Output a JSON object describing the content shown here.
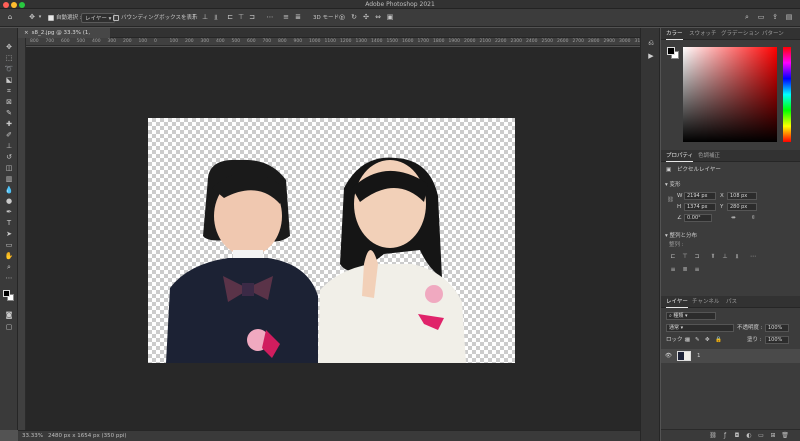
{
  "app": {
    "title": "Adobe Photoshop 2021"
  },
  "window_controls": {
    "close_color": "#ff5f57",
    "minimize_color": "#febc2e",
    "zoom_color": "#28c840"
  },
  "options_bar": {
    "auto_select_label": "自動選択 :",
    "auto_select_checked": true,
    "target_value": "レイヤー",
    "bounding_box_label": "バウンディングボックスを表示",
    "bounding_box_checked": false,
    "three_d_mode_label": "3D モード :"
  },
  "document": {
    "tab_label": "s8_2.jpg @ 33.3% (1, RGB/8) *",
    "ruler_ticks": [
      "800",
      "700",
      "600",
      "500",
      "400",
      "300",
      "200",
      "100",
      "0",
      "100",
      "200",
      "300",
      "400",
      "500",
      "600",
      "700",
      "800",
      "900",
      "1000",
      "1100",
      "1200",
      "1300",
      "1400",
      "1500",
      "1600",
      "1700",
      "1800",
      "1900",
      "2000",
      "2100",
      "2200",
      "2300",
      "2400",
      "2500",
      "2600",
      "2700",
      "2800",
      "2900",
      "3000",
      "3100"
    ]
  },
  "status": {
    "zoom": "33.33%",
    "info": "2480 px x 1654 px (350 ppi)"
  },
  "color_panel": {
    "tabs": [
      "カラー",
      "スウォッチ",
      "グラデーション",
      "パターン"
    ],
    "active_tab": 0,
    "foreground": "#000000",
    "background": "#ffffff"
  },
  "properties_panel": {
    "tabs": [
      "プロパティ",
      "色調補正"
    ],
    "active_tab": 0,
    "layer_kind": "ピクセルレイヤー",
    "transform_title": "変形",
    "w_label": "W",
    "w_value": "2194 px",
    "x_label": "X",
    "x_value": "108 px",
    "h_label": "H",
    "h_value": "1374 px",
    "y_label": "Y",
    "y_value": "280 px",
    "angle_value": "0.00°",
    "align_title": "整列と分布",
    "align_sub": "整列 :"
  },
  "layers_panel": {
    "tabs": [
      "レイヤー",
      "チャンネル",
      "パス"
    ],
    "active_tab": 0,
    "filter_kind": "種類",
    "blend_mode": "通常",
    "opacity_label": "不透明度 :",
    "opacity_value": "100%",
    "lock_label": "ロック :",
    "fill_label": "塗り :",
    "fill_value": "100%",
    "layers": [
      {
        "name": "1",
        "visible": true
      }
    ]
  }
}
